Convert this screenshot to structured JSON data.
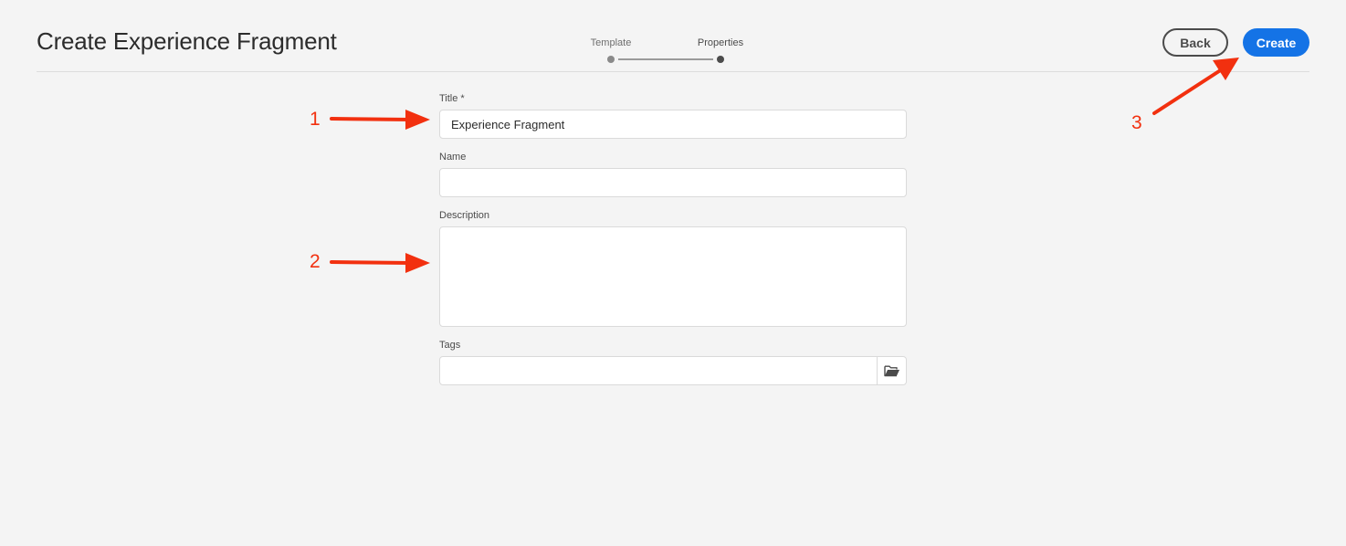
{
  "header": {
    "title": "Create Experience Fragment"
  },
  "wizard": {
    "steps": [
      {
        "label": "Template",
        "state": "completed"
      },
      {
        "label": "Properties",
        "state": "current"
      }
    ]
  },
  "actions": {
    "back_label": "Back",
    "create_label": "Create"
  },
  "form": {
    "title": {
      "label": "Title *",
      "value": "Experience Fragment"
    },
    "name": {
      "label": "Name",
      "value": ""
    },
    "description": {
      "label": "Description",
      "value": ""
    },
    "tags": {
      "label": "Tags",
      "value": "",
      "browse_icon": "folder-open-icon"
    }
  },
  "annotations": [
    {
      "number": "1"
    },
    {
      "number": "2"
    },
    {
      "number": "3"
    }
  ],
  "colors": {
    "background": "#f4f4f4",
    "accent": "#1473e6",
    "annotation": "#f2300f"
  }
}
